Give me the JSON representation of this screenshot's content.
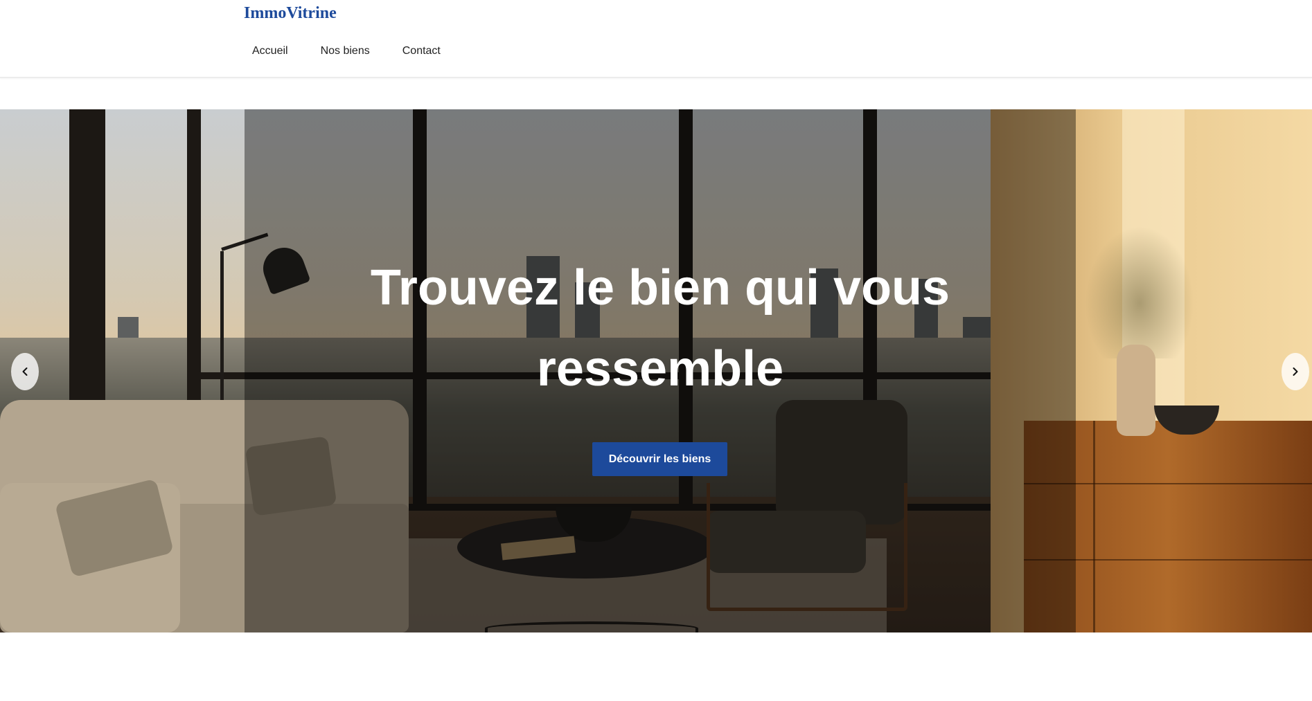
{
  "header": {
    "logo": "ImmoVitrine",
    "nav": [
      {
        "label": "Accueil"
      },
      {
        "label": "Nos biens"
      },
      {
        "label": "Contact"
      }
    ]
  },
  "hero": {
    "title_line1": "Trouvez le bien qui vous",
    "title_line2": "ressemble",
    "cta_label": "Découvrir les biens",
    "prev_icon": "chevron-left-icon",
    "next_icon": "chevron-right-icon"
  },
  "colors": {
    "brand": "#1d4a9b",
    "text": "#222222",
    "hero_text": "#ffffff"
  }
}
